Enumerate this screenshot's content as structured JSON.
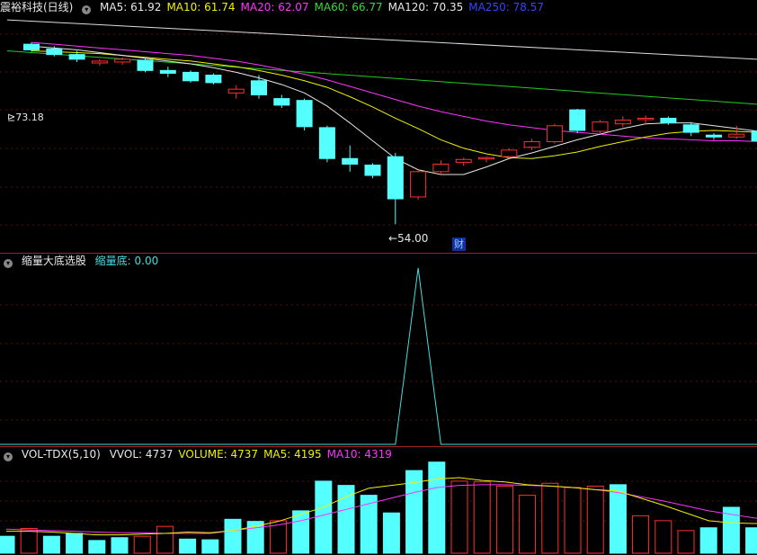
{
  "main": {
    "title": "震裕科技(日线)",
    "ma_items": [
      {
        "label": "MA5: 61.92",
        "color": "#e8e8e8"
      },
      {
        "label": "MA10: 61.74",
        "color": "#f0f000"
      },
      {
        "label": "MA20: 62.07",
        "color": "#ff33ff"
      },
      {
        "label": "MA60: 66.77",
        "color": "#33dd33"
      },
      {
        "label": "MA120: 70.35",
        "color": "#e8e8e8"
      },
      {
        "label": "MA250: 78.57",
        "color": "#3344ff"
      }
    ],
    "high_label": "73.18",
    "low_label": "54.00",
    "fin_marker": "财"
  },
  "indicator": {
    "title": "缩量大底选股",
    "value_label": "缩量底: 0.00",
    "value_color": "#44dddd"
  },
  "volume": {
    "title": "VOL-TDX(5,10)",
    "items": [
      {
        "label": "VVOL: 4737",
        "color": "#e8e8e8"
      },
      {
        "label": "VOLUME: 4737",
        "color": "#f0f000"
      },
      {
        "label": "MA5: 4195",
        "color": "#f0f000"
      },
      {
        "label": "MA10: 4319",
        "color": "#ff33ff"
      }
    ]
  },
  "chart_data": [
    {
      "type": "candlestick",
      "title": "震裕科技(日线)",
      "ylim": [
        52,
        76
      ],
      "candles": [
        {
          "o": 73.2,
          "h": 73.4,
          "l": 72.4,
          "c": 72.6
        },
        {
          "o": 72.7,
          "h": 73.0,
          "l": 71.9,
          "c": 72.1
        },
        {
          "o": 72.1,
          "h": 72.5,
          "l": 71.3,
          "c": 71.6
        },
        {
          "o": 71.2,
          "h": 71.6,
          "l": 70.9,
          "c": 71.4
        },
        {
          "o": 71.3,
          "h": 71.8,
          "l": 71.0,
          "c": 71.6
        },
        {
          "o": 71.5,
          "h": 71.7,
          "l": 70.2,
          "c": 70.4
        },
        {
          "o": 70.4,
          "h": 70.8,
          "l": 69.7,
          "c": 70.1
        },
        {
          "o": 70.2,
          "h": 70.4,
          "l": 69.1,
          "c": 69.3
        },
        {
          "o": 69.9,
          "h": 70.1,
          "l": 68.9,
          "c": 69.1
        },
        {
          "o": 68.0,
          "h": 68.8,
          "l": 67.4,
          "c": 68.4
        },
        {
          "o": 69.3,
          "h": 69.9,
          "l": 67.4,
          "c": 67.8
        },
        {
          "o": 67.4,
          "h": 67.8,
          "l": 66.4,
          "c": 66.7
        },
        {
          "o": 67.2,
          "h": 67.4,
          "l": 64.0,
          "c": 64.4
        },
        {
          "o": 64.3,
          "h": 64.5,
          "l": 60.6,
          "c": 61.0
        },
        {
          "o": 61.0,
          "h": 62.4,
          "l": 59.6,
          "c": 60.4
        },
        {
          "o": 60.3,
          "h": 60.5,
          "l": 58.9,
          "c": 59.2
        },
        {
          "o": 61.2,
          "h": 61.6,
          "l": 54.0,
          "c": 56.7
        },
        {
          "o": 56.9,
          "h": 59.8,
          "l": 56.6,
          "c": 59.6
        },
        {
          "o": 59.6,
          "h": 60.8,
          "l": 59.3,
          "c": 60.4
        },
        {
          "o": 60.6,
          "h": 61.1,
          "l": 60.2,
          "c": 60.9
        },
        {
          "o": 61.0,
          "h": 61.2,
          "l": 60.6,
          "c": 61.1
        },
        {
          "o": 61.2,
          "h": 62.1,
          "l": 61.0,
          "c": 61.9
        },
        {
          "o": 62.2,
          "h": 63.1,
          "l": 61.9,
          "c": 62.8
        },
        {
          "o": 62.8,
          "h": 64.7,
          "l": 62.6,
          "c": 64.5
        },
        {
          "o": 66.2,
          "h": 66.3,
          "l": 63.7,
          "c": 64.0
        },
        {
          "o": 63.9,
          "h": 65.1,
          "l": 63.7,
          "c": 64.9
        },
        {
          "o": 64.7,
          "h": 65.5,
          "l": 64.4,
          "c": 65.1
        },
        {
          "o": 65.2,
          "h": 65.6,
          "l": 64.7,
          "c": 65.3
        },
        {
          "o": 65.3,
          "h": 65.5,
          "l": 64.6,
          "c": 64.8
        },
        {
          "o": 64.6,
          "h": 64.9,
          "l": 63.4,
          "c": 63.8
        },
        {
          "o": 63.5,
          "h": 63.7,
          "l": 63.0,
          "c": 63.3
        },
        {
          "o": 63.3,
          "h": 64.5,
          "l": 63.1,
          "c": 63.6
        },
        {
          "o": 63.9,
          "h": 64.0,
          "l": 62.7,
          "c": 62.9
        }
      ],
      "ma5": [
        73.0,
        72.8,
        72.6,
        72.3,
        72.0,
        71.7,
        71.4,
        71.1,
        70.7,
        70.2,
        69.6,
        68.9,
        68.0,
        66.6,
        64.8,
        62.9,
        61.0,
        59.8,
        59.3,
        59.3,
        60.1,
        61.0,
        61.6,
        62.3,
        63.0,
        63.6,
        64.2,
        64.7,
        64.8,
        64.8,
        64.5,
        64.2,
        63.9
      ],
      "ma10": [
        72.5,
        72.4,
        72.3,
        72.2,
        72.0,
        71.8,
        71.6,
        71.4,
        71.1,
        70.8,
        70.4,
        69.9,
        69.3,
        68.6,
        67.6,
        66.5,
        65.3,
        64.2,
        63.0,
        62.1,
        61.5,
        61.1,
        61.0,
        61.3,
        61.7,
        62.3,
        62.8,
        63.3,
        63.7,
        63.9,
        64.0,
        63.9,
        63.8
      ],
      "ma20": [
        73.4,
        73.2,
        73.0,
        72.8,
        72.6,
        72.4,
        72.2,
        72.0,
        71.7,
        71.4,
        71.0,
        70.5,
        70.0,
        69.4,
        68.7,
        68.0,
        67.3,
        66.6,
        66.0,
        65.5,
        65.0,
        64.6,
        64.3,
        64.0,
        63.8,
        63.6,
        63.4,
        63.2,
        63.1,
        63.0,
        62.9,
        62.9,
        62.8
      ],
      "ma60_range": [
        72.5,
        66.8
      ],
      "ma120_range": [
        75.8,
        71.6
      ],
      "ma250_range": [
        89.5,
        80.0
      ],
      "annotations": [
        "73.18",
        "54.00",
        "财"
      ]
    },
    {
      "type": "line",
      "title": "缩量大底选股",
      "series": [
        {
          "name": "缩量底",
          "values": [
            0,
            0,
            0,
            0,
            0,
            0,
            0,
            0,
            0,
            0,
            0,
            0,
            0,
            0,
            0,
            0,
            0,
            1,
            0,
            0,
            0,
            0,
            0,
            0,
            0,
            0,
            0,
            0,
            0,
            0,
            0,
            0,
            0
          ]
        }
      ],
      "ylim": [
        0,
        1
      ]
    },
    {
      "type": "bar",
      "title": "VOL-TDX(5,10)",
      "values": [
        2400,
        3500,
        2400,
        2800,
        1800,
        2200,
        2400,
        3800,
        2000,
        1900,
        4800,
        4500,
        4600,
        6000,
        10200,
        9600,
        8200,
        5700,
        11700,
        12900,
        10200,
        10100,
        9500,
        8200,
        9900,
        9300,
        9500,
        9700,
        5300,
        4600,
        3200,
        3600,
        6500,
        3600,
        5200,
        3200
      ],
      "ma5": [
        3100,
        3100,
        3000,
        2800,
        2600,
        2600,
        2700,
        2800,
        3000,
        2900,
        3200,
        3800,
        4500,
        5500,
        6500,
        8000,
        9200,
        9600,
        10000,
        10500,
        10700,
        10300,
        10100,
        9700,
        9500,
        9300,
        9000,
        8800,
        7800,
        6800,
        5700,
        4600,
        4300,
        4200,
        4300,
        4195
      ],
      "ma10": [
        3400,
        3300,
        3200,
        3100,
        3000,
        2900,
        2900,
        2800,
        2800,
        2800,
        3200,
        3600,
        4000,
        4600,
        5400,
        6200,
        7000,
        7800,
        8600,
        9300,
        9600,
        9700,
        9700,
        9600,
        9500,
        9300,
        9000,
        8600,
        8000,
        7400,
        6700,
        6000,
        5500,
        5000,
        4600,
        4319
      ],
      "ylim": [
        0,
        13500
      ]
    }
  ]
}
